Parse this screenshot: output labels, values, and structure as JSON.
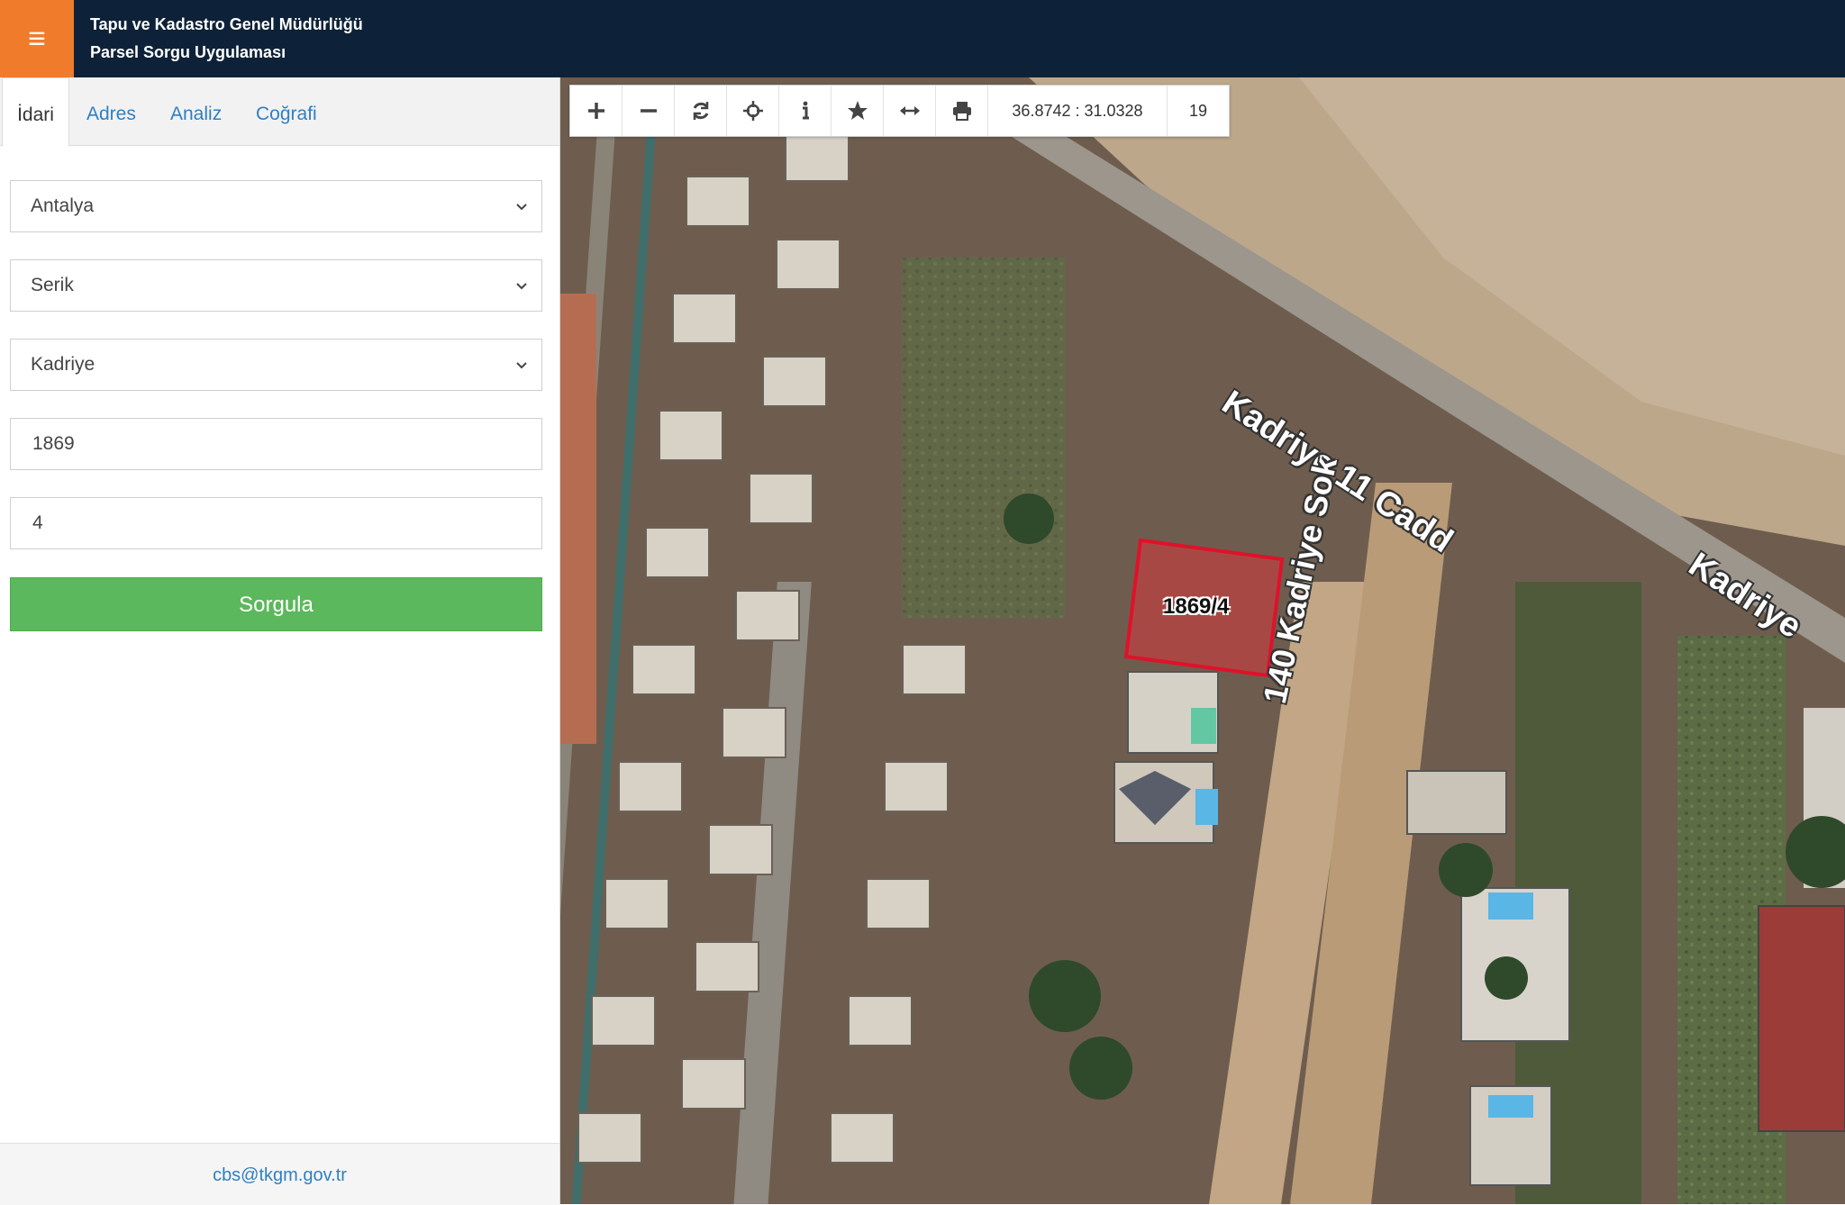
{
  "header": {
    "line1": "Tapu ve Kadastro Genel Müdürlüğü",
    "line2": "Parsel Sorgu Uygulaması",
    "menu_icon": "≡"
  },
  "tabs": [
    {
      "label": "İdari",
      "active": true
    },
    {
      "label": "Adres",
      "active": false
    },
    {
      "label": "Analiz",
      "active": false
    },
    {
      "label": "Coğrafi",
      "active": false
    }
  ],
  "form": {
    "province": "Antalya",
    "district": "Serik",
    "neighborhood": "Kadriye",
    "block": "1869",
    "parcel": "4",
    "submit_label": "Sorgula"
  },
  "footer": {
    "email": "cbs@tkgm.gov.tr"
  },
  "toolbar": {
    "coordinates": "36.8742 : 31.0328",
    "zoom": "19"
  },
  "map_labels": {
    "street1": "Kadriye 11 Cadd",
    "street2": "140 Kadriye Sok",
    "street3": "Kadriye",
    "parcel": "1869/4"
  },
  "colors": {
    "header_bg": "#0d2238",
    "menu_bg": "#f07b2b",
    "accent_link": "#2f7fc2",
    "submit_bg": "#5cb85c",
    "parcel_fill": "#d9373c"
  }
}
